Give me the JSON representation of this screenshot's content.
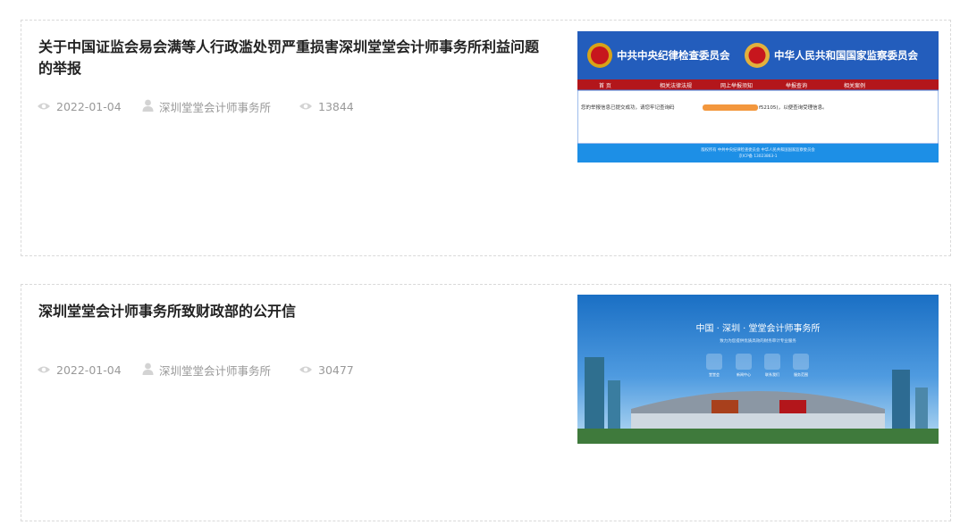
{
  "articles": [
    {
      "title": "关于中国证监会易会满等人行政滥处罚严重损害深圳堂堂会计师事务所利益问题的举报",
      "date": "2022-01-04",
      "author": "深圳堂堂会计师事务所",
      "views": "13844",
      "thumbnail": {
        "banner_left": "中共中央纪律检查委员会",
        "banner_right": "中华人民共和国国家监察委员会",
        "nav_items": [
          "首 页",
          "相关法律法规",
          "网上举报须知",
          "举报查询",
          "相关案例"
        ],
        "notice_text": "您的举报信息已提交成功，请您牢记查询码",
        "notice_tail": "f52105)，以便查询受理信息。",
        "footer_line1": "版权所有 中共中央纪律检查委员会 中华人民共和国国家监察委员会",
        "footer_line2": "京ICP备 13023863-1"
      }
    },
    {
      "title": "深圳堂堂会计师事务所致财政部的公开信",
      "date": "2022-01-04",
      "author": "深圳堂堂会计师事务所",
      "views": "30477",
      "thumbnail": {
        "headline": "中国 · 深圳 · 堂堂会计师事务所",
        "subline": "致力为您提供优质高效的财务审计专业服务",
        "icon_labels": [
          "堂堂会",
          "新闻中心",
          "联系我们",
          "服务范围"
        ]
      }
    }
  ],
  "icons": {
    "date": "eye-icon",
    "author": "user-icon",
    "views": "eye-icon"
  },
  "colors": {
    "title": "#222222",
    "meta": "#999999",
    "border": "#d9d9d9",
    "banner_blue": "#1f56b4",
    "nav_red": "#b3161b"
  }
}
